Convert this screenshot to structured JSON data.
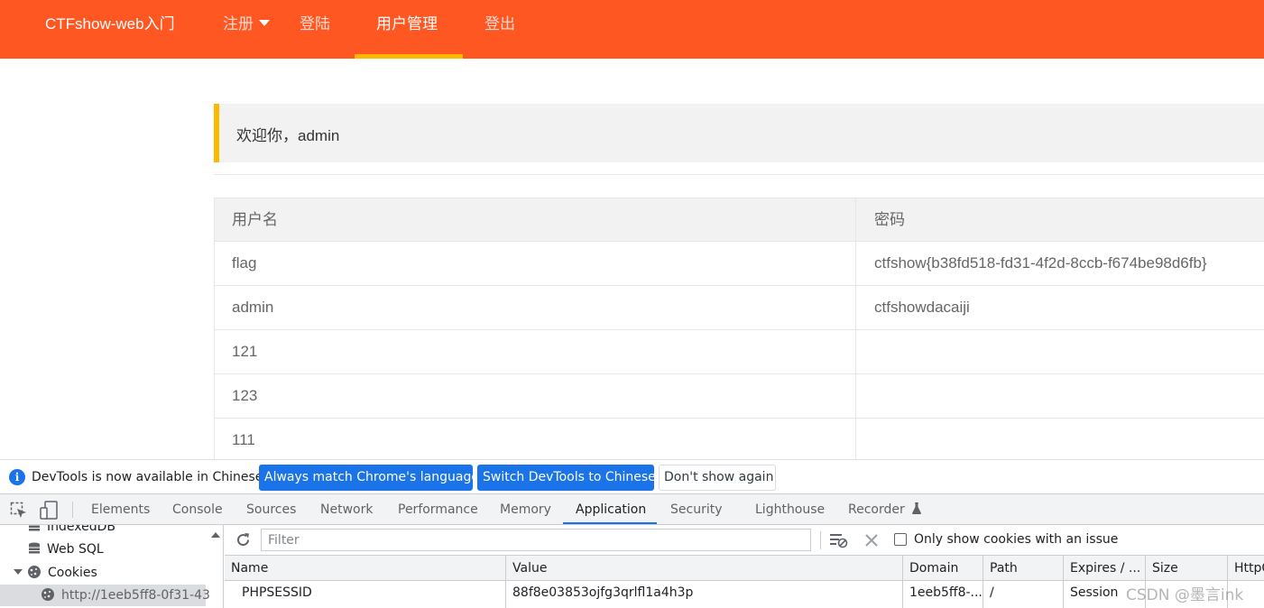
{
  "nav": {
    "brand": "CTFshow-web入门",
    "items": [
      "注册",
      "登陆",
      "用户管理",
      "登出"
    ],
    "active_index": 2
  },
  "welcome": "欢迎你，admin",
  "users_table": {
    "headers": [
      "用户名",
      "密码"
    ],
    "rows": [
      [
        "flag",
        "ctfshow{b38fd518-fd31-4f2d-8ccb-f674be98d6fb}"
      ],
      [
        "admin",
        "ctfshowdacaiji"
      ],
      [
        "121",
        ""
      ],
      [
        "123",
        ""
      ],
      [
        "111",
        ""
      ]
    ]
  },
  "devtools": {
    "info_message": "DevTools is now available in Chinese!",
    "buttons": [
      "Always match Chrome's language",
      "Switch DevTools to Chinese",
      "Don't show again"
    ],
    "tabs": [
      "Elements",
      "Console",
      "Sources",
      "Network",
      "Performance",
      "Memory",
      "Application",
      "Security",
      "Lighthouse",
      "Recorder"
    ],
    "active_tab": "Application",
    "sidebar": [
      "IndexedDB",
      "Web SQL",
      "Cookies",
      "http://1eeb5ff8-0f31-43"
    ],
    "filter_placeholder": "Filter",
    "only_issues_label": "Only show cookies with an issue",
    "cookie_columns": [
      "Name",
      "Value",
      "Domain",
      "Path",
      "Expires / ...",
      "Size",
      "HttpO"
    ],
    "cookie_rows": [
      [
        "PHPSESSID",
        "88f8e03853ojfg3qrlfl1a4h3p",
        "1eeb5ff8-...",
        "/",
        "Session",
        "",
        ""
      ]
    ]
  },
  "watermark": "CSDN @墨言ink",
  "colors": {
    "nav_bg": "#ff5722",
    "accent": "#ffb800",
    "devtools_blue": "#1a73e8"
  }
}
